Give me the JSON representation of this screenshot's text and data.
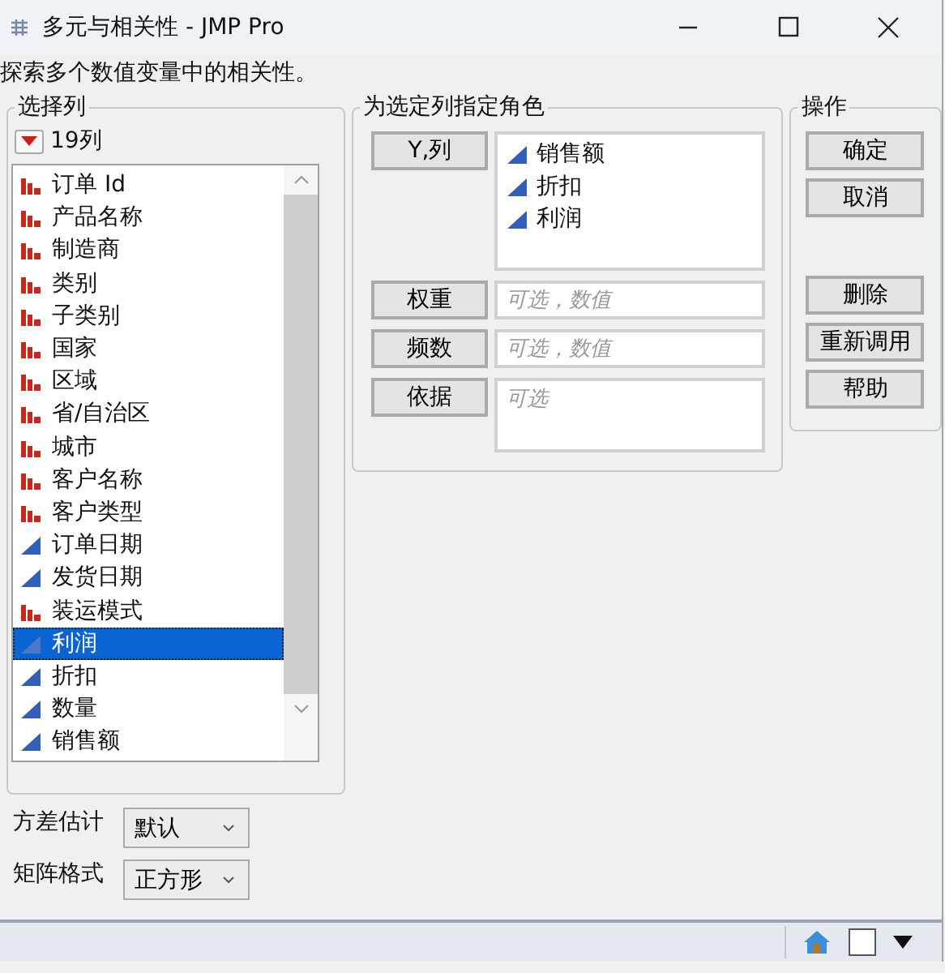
{
  "window": {
    "title": "多元与相关性 - JMP Pro"
  },
  "description": "探索多个数值变量中的相关性。",
  "select_columns": {
    "title": "选择列",
    "count": "19列",
    "columns": [
      {
        "name": "订单 Id",
        "kind": "nominal",
        "selected": false
      },
      {
        "name": "产品名称",
        "kind": "nominal",
        "selected": false
      },
      {
        "name": "制造商",
        "kind": "nominal",
        "selected": false
      },
      {
        "name": "类别",
        "kind": "nominal",
        "selected": false
      },
      {
        "name": "子类别",
        "kind": "nominal",
        "selected": false
      },
      {
        "name": "国家",
        "kind": "nominal",
        "selected": false
      },
      {
        "name": "区域",
        "kind": "nominal",
        "selected": false
      },
      {
        "name": "省/自治区",
        "kind": "nominal",
        "selected": false
      },
      {
        "name": "城市",
        "kind": "nominal",
        "selected": false
      },
      {
        "name": "客户名称",
        "kind": "nominal",
        "selected": false
      },
      {
        "name": "客户类型",
        "kind": "nominal",
        "selected": false
      },
      {
        "name": "订单日期",
        "kind": "continuous",
        "selected": false
      },
      {
        "name": "发货日期",
        "kind": "continuous",
        "selected": false
      },
      {
        "name": "装运模式",
        "kind": "nominal",
        "selected": false
      },
      {
        "name": "利润",
        "kind": "continuous",
        "selected": true
      },
      {
        "name": "折扣",
        "kind": "continuous",
        "selected": false
      },
      {
        "name": "数量",
        "kind": "continuous",
        "selected": false
      },
      {
        "name": "销售额",
        "kind": "continuous",
        "selected": false
      }
    ]
  },
  "roles": {
    "title": "为选定列指定角色",
    "items": [
      {
        "button": "Y,列",
        "kind": "list",
        "values": [
          {
            "name": "销售额",
            "kind": "continuous"
          },
          {
            "name": "折扣",
            "kind": "continuous"
          },
          {
            "name": "利润",
            "kind": "continuous"
          }
        ]
      },
      {
        "button": "权重",
        "kind": "field",
        "placeholder": "可选，数值"
      },
      {
        "button": "频数",
        "kind": "field",
        "placeholder": "可选，数值"
      },
      {
        "button": "依据",
        "kind": "area",
        "placeholder": "可选"
      }
    ]
  },
  "actions": {
    "title": "操作",
    "groups": [
      [
        "确定",
        "取消"
      ],
      [
        "删除",
        "重新调用",
        "帮助"
      ]
    ]
  },
  "options": [
    {
      "label": "方差估计",
      "value": "默认"
    },
    {
      "label": "矩阵格式",
      "value": "正方形"
    }
  ]
}
